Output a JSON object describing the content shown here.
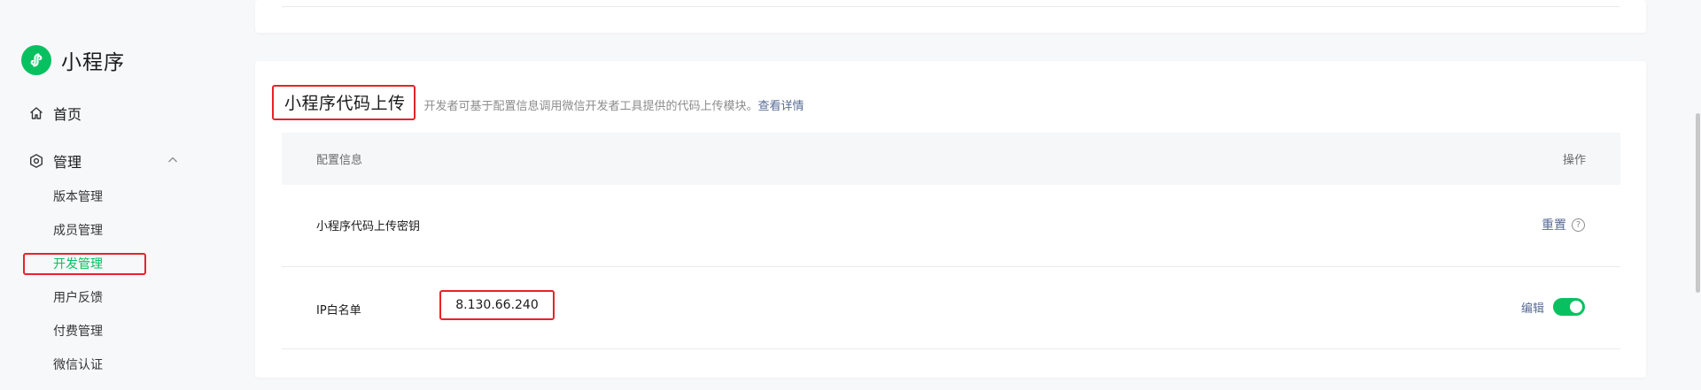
{
  "app": {
    "name": "小程序",
    "logo_icon": "miniprogram-logo-icon",
    "brand_color": "#07c160"
  },
  "sidebar": {
    "home": {
      "label": "首页",
      "icon": "home-icon"
    },
    "manage": {
      "label": "管理",
      "icon": "manage-icon",
      "expanded": true
    },
    "subitems": [
      {
        "label": "版本管理"
      },
      {
        "label": "成员管理"
      },
      {
        "label": "开发管理",
        "active": true
      },
      {
        "label": "用户反馈"
      },
      {
        "label": "付费管理"
      },
      {
        "label": "微信认证"
      }
    ]
  },
  "section": {
    "title": "小程序代码上传",
    "description": "开发者可基于配置信息调用微信开发者工具提供的代码上传模块。",
    "detail_link": "查看详情",
    "table": {
      "header_left": "配置信息",
      "header_right": "操作",
      "rows": [
        {
          "label": "小程序代码上传密钥",
          "action": "重置",
          "help_icon": "question-icon",
          "help_text": "?"
        },
        {
          "label": "IP白名单",
          "value": "8.130.66.240",
          "action": "编辑",
          "toggle_on": true
        }
      ]
    }
  },
  "colors": {
    "highlight": "#e7222b",
    "link": "#576b95",
    "active": "#07c160"
  }
}
